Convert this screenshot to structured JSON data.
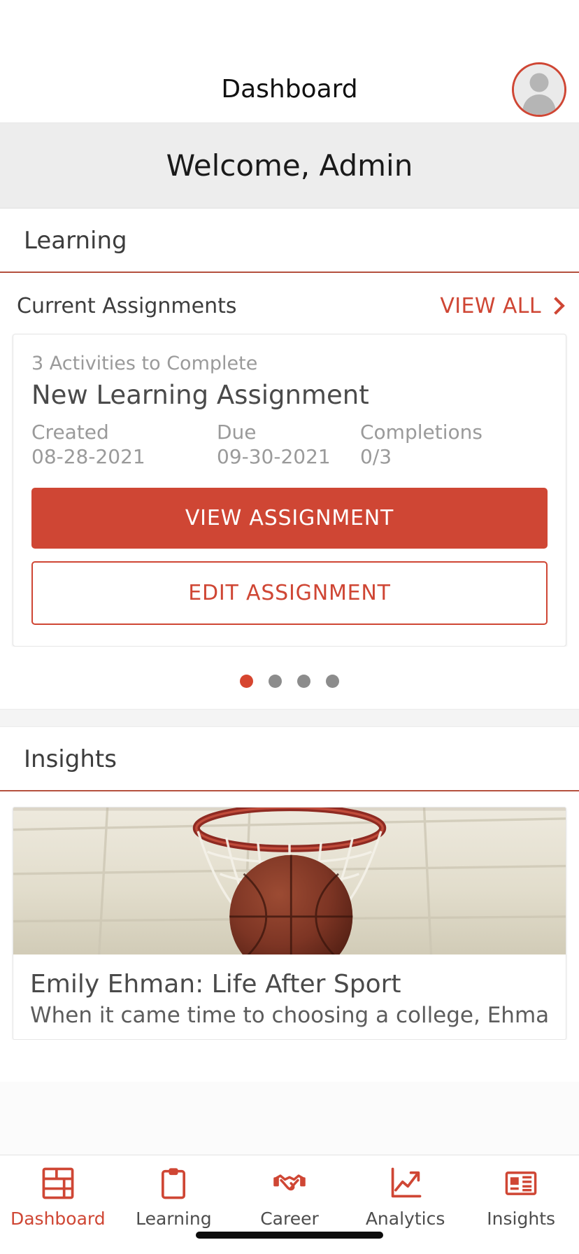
{
  "header": {
    "title": "Dashboard",
    "avatar_icon": "user-avatar-icon",
    "accent_color": "#cf4634"
  },
  "welcome": {
    "text": "Welcome, Admin"
  },
  "learning_section": {
    "title": "Learning",
    "subhead": "Current Assignments",
    "view_all_label": "VIEW ALL",
    "view_all_icon": "chevron-right-icon",
    "card": {
      "activities_text": "3 Activities to Complete",
      "title": "New Learning Assignment",
      "meta": [
        {
          "label": "Created",
          "value": "08-28-2021"
        },
        {
          "label": "Due",
          "value": "09-30-2021"
        },
        {
          "label": "Completions",
          "value": "0/3"
        }
      ],
      "primary_button": "VIEW ASSIGNMENT",
      "secondary_button": "EDIT ASSIGNMENT"
    },
    "carousel": {
      "total_dots": 4,
      "active_index": 0
    }
  },
  "insights_section": {
    "title": "Insights",
    "card": {
      "image_alt": "basketball-through-hoop-image",
      "title": "Emily Ehman: Life After Sport",
      "description": "When it came time to choosing a college, Ehman"
    }
  },
  "bottom_nav": {
    "active_index": 0,
    "items": [
      {
        "label": "Dashboard",
        "icon": "dashboard-grid-icon"
      },
      {
        "label": "Learning",
        "icon": "clipboard-icon"
      },
      {
        "label": "Career",
        "icon": "handshake-icon"
      },
      {
        "label": "Analytics",
        "icon": "trending-up-chart-icon"
      },
      {
        "label": "Insights",
        "icon": "newspaper-icon"
      }
    ]
  }
}
